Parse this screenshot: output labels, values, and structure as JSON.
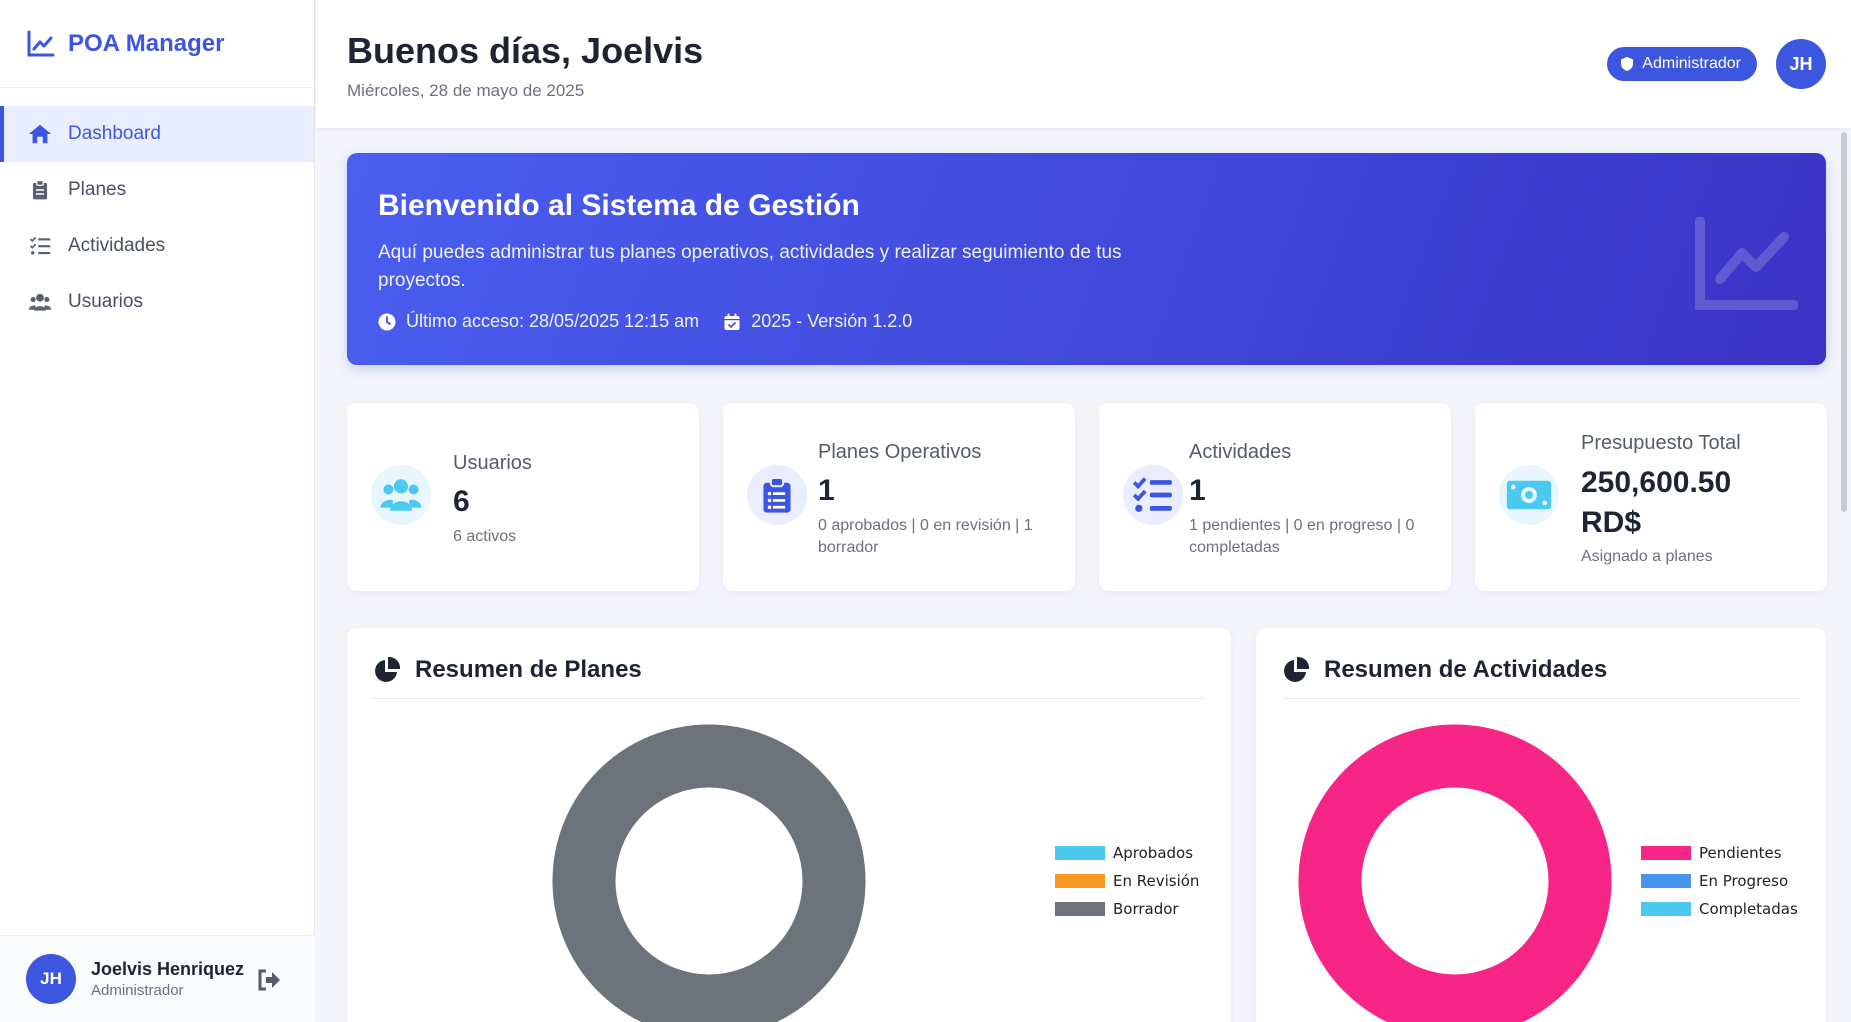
{
  "app": {
    "name": "POA Manager"
  },
  "sidebar": {
    "items": [
      {
        "label": "Dashboard",
        "icon": "home-icon",
        "active": true
      },
      {
        "label": "Planes",
        "icon": "clipboard-icon",
        "active": false
      },
      {
        "label": "Actividades",
        "icon": "tasks-icon",
        "active": false
      },
      {
        "label": "Usuarios",
        "icon": "users-icon",
        "active": false
      }
    ],
    "user": {
      "initials": "JH",
      "name": "Joelvis Henriquez",
      "role": "Administrador"
    }
  },
  "header": {
    "greeting": "Buenos días, Joelvis",
    "date": "Miércoles, 28 de mayo de 2025",
    "role_badge": "Administrador",
    "avatar_initials": "JH"
  },
  "banner": {
    "title": "Bienvenido al Sistema de Gestión",
    "description": "Aquí puedes administrar tus planes operativos, actividades y realizar seguimiento de tus proyectos.",
    "last_access": "Último acceso: 28/05/2025 12:15 am",
    "version": "2025 - Versión 1.2.0"
  },
  "stats": [
    {
      "label": "Usuarios",
      "value": "6",
      "sub": "6 activos",
      "icon": "users-icon"
    },
    {
      "label": "Planes Operativos",
      "value": "1",
      "sub": "0 aprobados | 0 en revisión | 1 borrador",
      "icon": "clipboard-icon"
    },
    {
      "label": "Actividades",
      "value": "1",
      "sub": "1 pendientes | 0 en progreso | 0 completadas",
      "icon": "tasks-icon"
    },
    {
      "label": "Presupuesto Total",
      "value": "250,600.50 RD$",
      "sub": "Asignado a planes",
      "icon": "money-icon"
    }
  ],
  "panels": {
    "plans": {
      "title": "Resumen de Planes",
      "legend": [
        {
          "label": "Aprobados",
          "color": "#4bc9ef",
          "value": 0
        },
        {
          "label": "En Revisión",
          "color": "#fa9a24",
          "value": 0
        },
        {
          "label": "Borrador",
          "color": "#6c737b",
          "value": 1
        }
      ]
    },
    "activities": {
      "title": "Resumen de Actividades",
      "legend": [
        {
          "label": "Pendientes",
          "color": "#f72585",
          "value": 1
        },
        {
          "label": "En Progreso",
          "color": "#4895ef",
          "value": 0
        },
        {
          "label": "Completadas",
          "color": "#4cc9f0",
          "value": 0
        }
      ]
    }
  },
  "colors": {
    "primary": "#3d56e0"
  }
}
